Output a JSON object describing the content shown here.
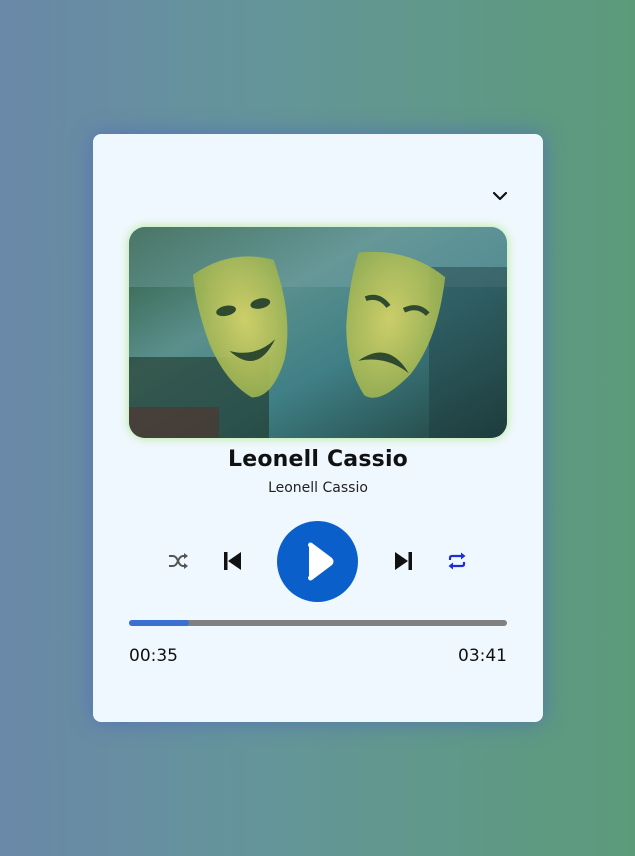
{
  "player": {
    "track_title": "Leonell Cassio",
    "track_artist": "Leonell Cassio",
    "current_time": "00:35",
    "total_time": "03:41",
    "progress_fraction": 0.16,
    "repeat_active": true,
    "accent_color": "#0b5fcb",
    "repeat_color": "#1a2fd6"
  },
  "icons": {
    "collapse": "chevron-down-icon",
    "shuffle": "shuffle-icon",
    "previous": "skip-previous-icon",
    "play": "play-icon",
    "next": "skip-next-icon",
    "repeat": "repeat-icon"
  }
}
